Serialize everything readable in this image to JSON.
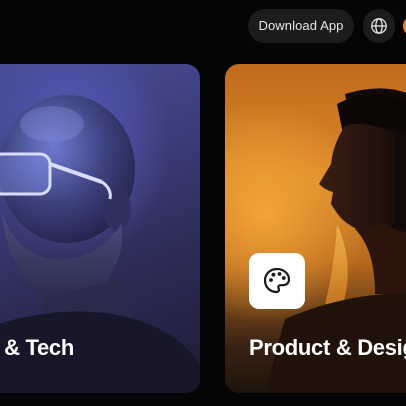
{
  "header": {
    "download_label": "Download App",
    "globe_icon": "globe-icon",
    "accent": "#ff7a1a"
  },
  "cards": [
    {
      "title": "ng & Tech",
      "image": "man-with-clear-glasses-portrait",
      "tint": "#3b3d7a"
    },
    {
      "title": "Product & Desig",
      "image": "woman-profile-portrait",
      "icon": "palette-icon",
      "tint": "#d98a2a"
    }
  ]
}
